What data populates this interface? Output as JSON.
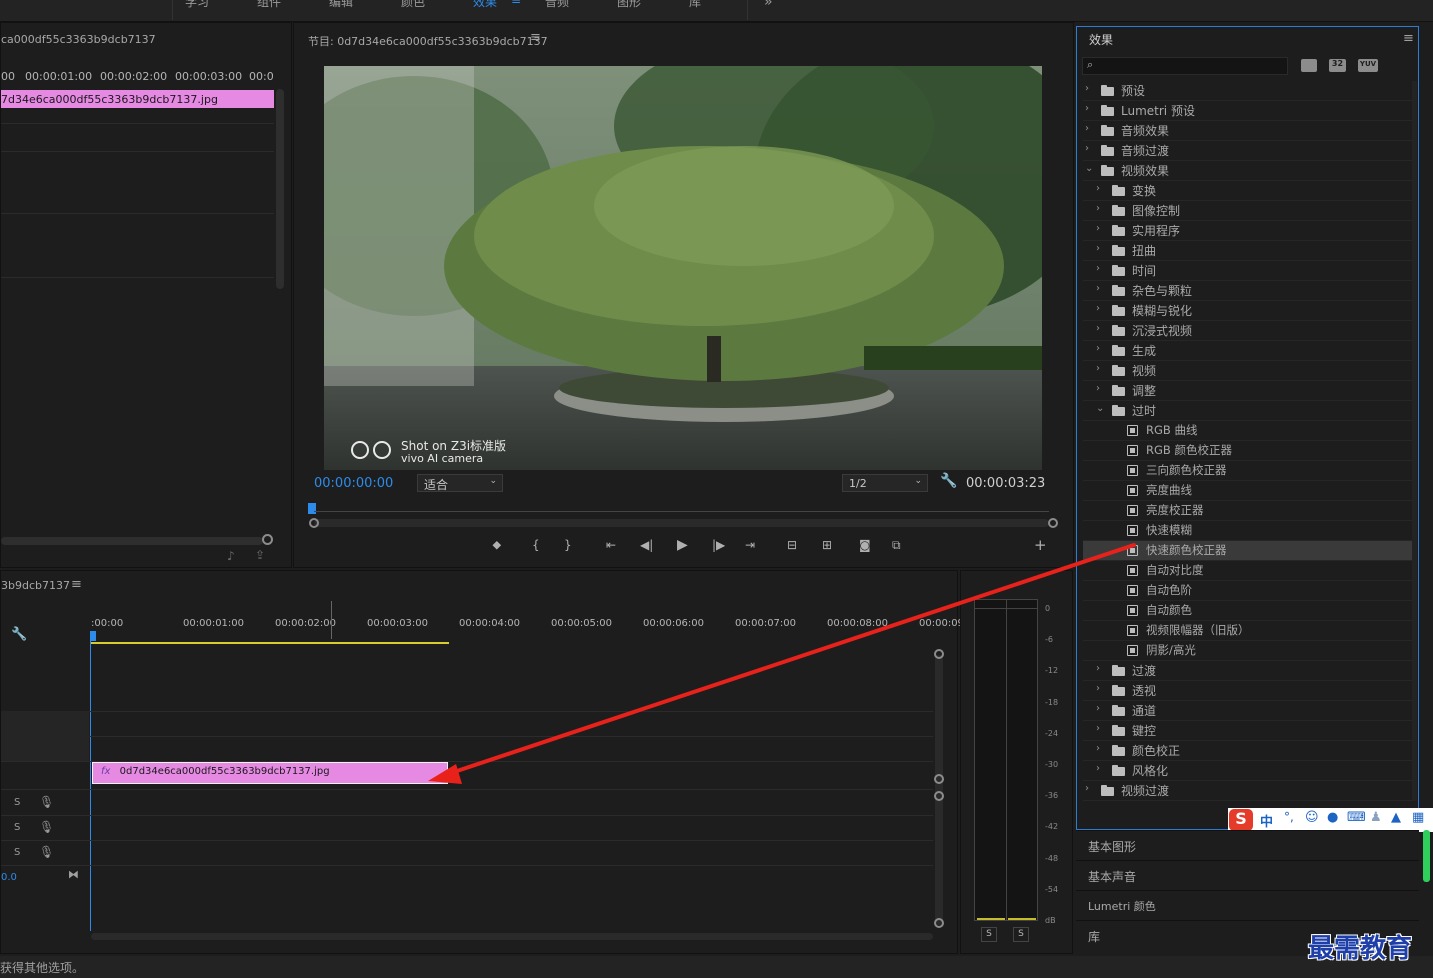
{
  "top_tabs": [
    {
      "label": "学习",
      "active": false
    },
    {
      "label": "组件",
      "active": false
    },
    {
      "label": "编辑",
      "active": false
    },
    {
      "label": "颜色",
      "active": false
    },
    {
      "label": "效果",
      "active": true
    },
    {
      "label": "音频",
      "active": false
    },
    {
      "label": "图形",
      "active": false
    },
    {
      "label": "库",
      "active": false
    }
  ],
  "source": {
    "title": "ca000df55c3363b9dcb7137",
    "ruler": [
      "00",
      "00:00:01:00",
      "00:00:02:00",
      "00:00:03:00",
      "00:0"
    ],
    "clip_name": "7d34e6ca000df55c3363b9dcb7137.jpg"
  },
  "program": {
    "title": "节目: 0d7d34e6ca000df55c3363b9dcb7137",
    "watermark_line1": "Shot on Z3i标准版",
    "watermark_line2": "vivo AI camera",
    "timecode_current": "00:00:00:00",
    "fit_label": "适合",
    "resolution": "1/2",
    "timecode_duration": "00:00:03:23"
  },
  "timeline": {
    "title": "3b9dcb7137",
    "ruler": [
      ":00:00",
      "00:00:01:00",
      "00:00:02:00",
      "00:00:03:00",
      "00:00:04:00",
      "00:00:05:00",
      "00:00:06:00",
      "00:00:07:00",
      "00:00:08:00",
      "00:00:09:"
    ],
    "clip_fx": "fx",
    "clip_name": "0d7d34e6ca000df55c3363b9dcb7137.jpg",
    "track_s": "S",
    "track_value": "0.0"
  },
  "meters": {
    "scale": [
      "0",
      "-6",
      "-12",
      "-18",
      "-24",
      "-30",
      "-36",
      "-42",
      "-48",
      "-54",
      "dB"
    ],
    "solo_left": "S",
    "solo_right": "S"
  },
  "effects": {
    "title": "效果",
    "accel_badges": [
      "32",
      "YUV"
    ],
    "tree": [
      {
        "label": "预设",
        "level": 0,
        "kind": "preset",
        "open": false
      },
      {
        "label": "Lumetri 预设",
        "level": 0,
        "kind": "preset",
        "open": false
      },
      {
        "label": "音频效果",
        "level": 0,
        "kind": "folder",
        "open": false
      },
      {
        "label": "音频过渡",
        "level": 0,
        "kind": "folder",
        "open": false
      },
      {
        "label": "视频效果",
        "level": 0,
        "kind": "folder",
        "open": true
      },
      {
        "label": "变换",
        "level": 1,
        "kind": "folder",
        "open": false
      },
      {
        "label": "图像控制",
        "level": 1,
        "kind": "folder",
        "open": false
      },
      {
        "label": "实用程序",
        "level": 1,
        "kind": "folder",
        "open": false
      },
      {
        "label": "扭曲",
        "level": 1,
        "kind": "folder",
        "open": false
      },
      {
        "label": "时间",
        "level": 1,
        "kind": "folder",
        "open": false
      },
      {
        "label": "杂色与颗粒",
        "level": 1,
        "kind": "folder",
        "open": false
      },
      {
        "label": "模糊与锐化",
        "level": 1,
        "kind": "folder",
        "open": false
      },
      {
        "label": "沉浸式视频",
        "level": 1,
        "kind": "folder",
        "open": false
      },
      {
        "label": "生成",
        "level": 1,
        "kind": "folder",
        "open": false
      },
      {
        "label": "视频",
        "level": 1,
        "kind": "folder",
        "open": false
      },
      {
        "label": "调整",
        "level": 1,
        "kind": "folder",
        "open": false
      },
      {
        "label": "过时",
        "level": 1,
        "kind": "folder",
        "open": true
      },
      {
        "label": "RGB 曲线",
        "level": 2,
        "kind": "effect"
      },
      {
        "label": "RGB 颜色校正器",
        "level": 2,
        "kind": "effect"
      },
      {
        "label": "三向颜色校正器",
        "level": 2,
        "kind": "effect"
      },
      {
        "label": "亮度曲线",
        "level": 2,
        "kind": "effect"
      },
      {
        "label": "亮度校正器",
        "level": 2,
        "kind": "effect"
      },
      {
        "label": "快速模糊",
        "level": 2,
        "kind": "effect"
      },
      {
        "label": "快速颜色校正器",
        "level": 2,
        "kind": "effect",
        "selected": true
      },
      {
        "label": "自动对比度",
        "level": 2,
        "kind": "effect"
      },
      {
        "label": "自动色阶",
        "level": 2,
        "kind": "effect"
      },
      {
        "label": "自动颜色",
        "level": 2,
        "kind": "effect"
      },
      {
        "label": "视频限幅器（旧版）",
        "level": 2,
        "kind": "effect"
      },
      {
        "label": "阴影/高光",
        "level": 2,
        "kind": "effect"
      },
      {
        "label": "过渡",
        "level": 1,
        "kind": "folder",
        "open": false
      },
      {
        "label": "透视",
        "level": 1,
        "kind": "folder",
        "open": false
      },
      {
        "label": "通道",
        "level": 1,
        "kind": "folder",
        "open": false
      },
      {
        "label": "键控",
        "level": 1,
        "kind": "folder",
        "open": false
      },
      {
        "label": "颜色校正",
        "level": 1,
        "kind": "folder",
        "open": false
      },
      {
        "label": "风格化",
        "level": 1,
        "kind": "folder",
        "open": false
      },
      {
        "label": "视频过渡",
        "level": 0,
        "kind": "folder",
        "open": false
      }
    ]
  },
  "bottom_tabs": [
    "基本图形",
    "基本声音",
    "Lumetri 颜色",
    "库"
  ],
  "ime": {
    "lang": "中"
  },
  "status_text": "获得其他选项。",
  "brand": "最需教育",
  "colors": {
    "accent": "#2d8ceb",
    "clip": "#e589e3",
    "arrow": "#e8221b",
    "brand": "#1f3fa8"
  }
}
